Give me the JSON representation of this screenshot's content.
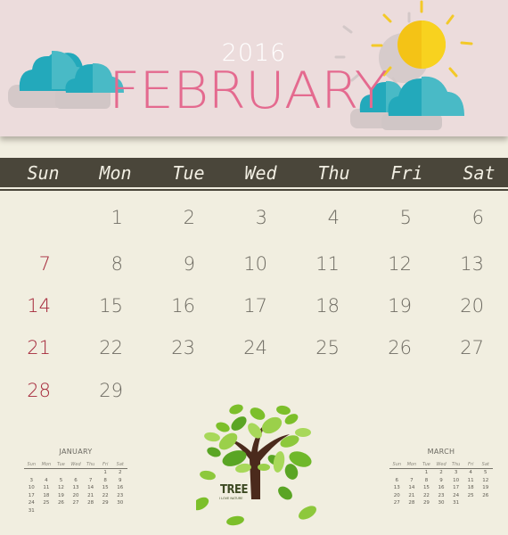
{
  "header": {
    "year": "2016",
    "month": "FEBRUARY"
  },
  "weekdays": [
    "Sun",
    "Mon",
    "Tue",
    "Wed",
    "Thu",
    "Fri",
    "Sat"
  ],
  "month_grid": [
    [
      "",
      "1",
      "2",
      "3",
      "4",
      "5",
      "6"
    ],
    [
      "7",
      "8",
      "9",
      "10",
      "11",
      "12",
      "13"
    ],
    [
      "14",
      "15",
      "16",
      "17",
      "18",
      "19",
      "20"
    ],
    [
      "21",
      "22",
      "23",
      "24",
      "25",
      "26",
      "27"
    ],
    [
      "28",
      "29",
      "",
      "",
      "",
      "",
      ""
    ]
  ],
  "mini_prev": {
    "title": "JANUARY",
    "weekdays": [
      "Sun",
      "Mon",
      "Tue",
      "Wed",
      "Thu",
      "Fri",
      "Sat"
    ],
    "rows": [
      [
        "",
        "",
        "",
        "",
        "",
        "1",
        "2"
      ],
      [
        "3",
        "4",
        "5",
        "6",
        "7",
        "8",
        "9"
      ],
      [
        "10",
        "11",
        "12",
        "13",
        "14",
        "15",
        "16"
      ],
      [
        "17",
        "18",
        "19",
        "20",
        "21",
        "22",
        "23"
      ],
      [
        "24",
        "25",
        "26",
        "27",
        "28",
        "29",
        "30"
      ],
      [
        "31",
        "",
        "",
        "",
        "",
        "",
        ""
      ]
    ]
  },
  "mini_next": {
    "title": "MARCH",
    "weekdays": [
      "Sun",
      "Mon",
      "Tue",
      "Wed",
      "Thu",
      "Fri",
      "Sat"
    ],
    "rows": [
      [
        "",
        "",
        "1",
        "2",
        "3",
        "4",
        "5"
      ],
      [
        "6",
        "7",
        "8",
        "9",
        "10",
        "11",
        "12"
      ],
      [
        "13",
        "14",
        "15",
        "16",
        "17",
        "18",
        "19"
      ],
      [
        "20",
        "21",
        "22",
        "23",
        "24",
        "25",
        "26"
      ],
      [
        "27",
        "28",
        "29",
        "30",
        "31",
        "",
        ""
      ]
    ]
  },
  "illustration": {
    "title": "TREE",
    "subtitle": "I LOVE NATURE",
    "icons": [
      "cloud-icon",
      "sun-icon",
      "tree-icon",
      "leaf-icon"
    ]
  },
  "colors": {
    "banner": "#ecdcdc",
    "month_text": "#e46a8f",
    "weekday_bar": "#4a463a",
    "sunday": "#a5283a",
    "weekday_number": "#6f6c63",
    "cloud": "#2aaebe",
    "sun": "#f6c515",
    "leaf": "#7cbf2a",
    "trunk": "#4b2a1c"
  }
}
